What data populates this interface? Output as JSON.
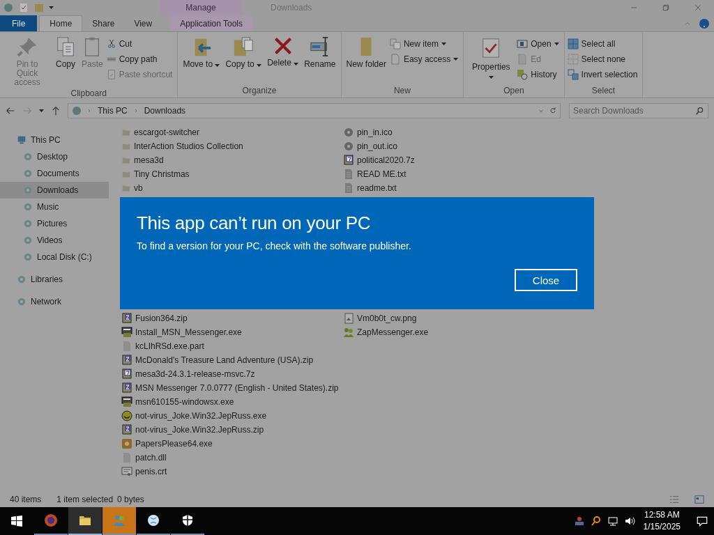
{
  "window": {
    "title": "Downloads",
    "context_group": "Manage"
  },
  "tabs": [
    {
      "label": "File",
      "kind": "file",
      "selected": false
    },
    {
      "label": "Home",
      "kind": "tab",
      "selected": true
    },
    {
      "label": "Share",
      "kind": "tab",
      "selected": false
    },
    {
      "label": "View",
      "kind": "tab",
      "selected": false
    },
    {
      "label": "Application Tools",
      "kind": "context",
      "selected": false
    }
  ],
  "ribbon": {
    "groups": [
      {
        "label": "Clipboard",
        "items": [
          {
            "kind": "large",
            "label": "Pin to Quick access",
            "disabled": true,
            "dropdown": false
          },
          {
            "kind": "large",
            "label": "Copy",
            "disabled": false,
            "dropdown": false
          },
          {
            "kind": "large",
            "label": "Paste",
            "disabled": true,
            "dropdown": false
          },
          {
            "kind": "stack",
            "items": [
              {
                "label": "Cut",
                "disabled": false,
                "dropdown": false
              },
              {
                "label": "Copy path",
                "disabled": false,
                "dropdown": false
              },
              {
                "label": "Paste shortcut",
                "disabled": true,
                "dropdown": false
              }
            ]
          }
        ]
      },
      {
        "label": "Organize",
        "items": [
          {
            "kind": "large",
            "label": "Move to",
            "disabled": false,
            "dropdown": true
          },
          {
            "kind": "large",
            "label": "Copy to",
            "disabled": false,
            "dropdown": true
          },
          {
            "kind": "large",
            "label": "Delete",
            "disabled": false,
            "dropdown": true
          },
          {
            "kind": "large",
            "label": "Rename",
            "disabled": false,
            "dropdown": false
          }
        ]
      },
      {
        "label": "New",
        "items": [
          {
            "kind": "large",
            "label": "New folder",
            "disabled": false,
            "dropdown": false
          },
          {
            "kind": "stack",
            "items": [
              {
                "label": "New item",
                "disabled": false,
                "dropdown": true
              },
              {
                "label": "Easy access",
                "disabled": false,
                "dropdown": true
              }
            ]
          }
        ]
      },
      {
        "label": "Open",
        "items": [
          {
            "kind": "large",
            "label": "Properties",
            "disabled": false,
            "dropdown": true
          },
          {
            "kind": "stack",
            "items": [
              {
                "label": "Open",
                "disabled": false,
                "dropdown": true
              },
              {
                "label": "Ed",
                "disabled": true,
                "dropdown": false
              },
              {
                "label": "History",
                "disabled": false,
                "dropdown": false
              }
            ]
          }
        ]
      },
      {
        "label": "Select",
        "items": [
          {
            "kind": "stack",
            "items": [
              {
                "label": "Select all",
                "disabled": false,
                "dropdown": false
              },
              {
                "label": "Select none",
                "disabled": false,
                "dropdown": false
              },
              {
                "label": "Invert selection",
                "disabled": false,
                "dropdown": false
              }
            ]
          }
        ]
      }
    ]
  },
  "address": {
    "crumbs": [
      "This PC",
      "Downloads"
    ],
    "search_placeholder": "Search Downloads"
  },
  "sidebar": {
    "items": [
      {
        "label": "This PC",
        "selected": false,
        "children": [
          {
            "label": "Desktop",
            "selected": false
          },
          {
            "label": "Documents",
            "selected": false
          },
          {
            "label": "Downloads",
            "selected": true
          },
          {
            "label": "Music",
            "selected": false
          },
          {
            "label": "Pictures",
            "selected": false
          },
          {
            "label": "Videos",
            "selected": false
          },
          {
            "label": "Local Disk (C:)",
            "selected": false
          }
        ]
      },
      {
        "label": "Libraries",
        "selected": false
      },
      {
        "label": "Network",
        "selected": false
      }
    ]
  },
  "files": {
    "columns": [
      {
        "top": [
          {
            "name": "escargot-switcher",
            "kind": "folder"
          },
          {
            "name": "InterAction Studios Collection",
            "kind": "folder"
          },
          {
            "name": "mesa3d",
            "kind": "folder"
          },
          {
            "name": "Tiny Christmas",
            "kind": "folder"
          },
          {
            "name": "vb",
            "kind": "folder"
          }
        ],
        "bottom": [
          {
            "name": "Fusion364.zip",
            "kind": "archive"
          },
          {
            "name": "Install_MSN_Messenger.exe",
            "kind": "program"
          },
          {
            "name": "kcLIhRSd.exe.part",
            "kind": "blank"
          },
          {
            "name": "McDonald's Treasure Land Adventure (USA).zip",
            "kind": "archive"
          },
          {
            "name": "mesa3d-24.3.1-release-msvc.7z",
            "kind": "archive7"
          },
          {
            "name": "MSN Messenger 7.0.0777 (English - United States).zip",
            "kind": "archive"
          },
          {
            "name": "msn610155-windowsx.exe",
            "kind": "program"
          },
          {
            "name": "not-virus_Joke.Win32.JepRuss.exe",
            "kind": "smiley"
          },
          {
            "name": "not-virus_Joke.Win32.JepRuss.zip",
            "kind": "archive"
          },
          {
            "name": "PapersPlease64.exe",
            "kind": "badge"
          },
          {
            "name": "patch.dll",
            "kind": "blank"
          },
          {
            "name": "penis.crt",
            "kind": "certificate"
          }
        ]
      },
      {
        "top": [
          {
            "name": "pin_in.ico",
            "kind": "gear"
          },
          {
            "name": "pin_out.ico",
            "kind": "gear"
          },
          {
            "name": "political2020.7z",
            "kind": "archive7"
          },
          {
            "name": "READ ME.txt",
            "kind": "text"
          },
          {
            "name": "readme.txt",
            "kind": "text"
          }
        ],
        "bottom": [
          {
            "name": "Vm0b0t_cw.png",
            "kind": "image"
          },
          {
            "name": "ZapMessenger.exe",
            "kind": "people"
          }
        ]
      }
    ]
  },
  "status_bar": {
    "count": "40 items",
    "selection": "1 item selected",
    "size": "0 bytes"
  },
  "dialog": {
    "title": "This app can’t run on your PC",
    "message": "To find a version for your PC, check with the software publisher.",
    "button": "Close"
  },
  "taskbar": {
    "apps": [
      {
        "selected": false,
        "attention": false
      },
      {
        "selected": true,
        "attention": false
      },
      {
        "selected": false,
        "attention": true
      },
      {
        "selected": false,
        "attention": false
      },
      {
        "selected": false,
        "attention": false
      }
    ],
    "time": "12:58 AM",
    "date": "1/15/2025"
  }
}
